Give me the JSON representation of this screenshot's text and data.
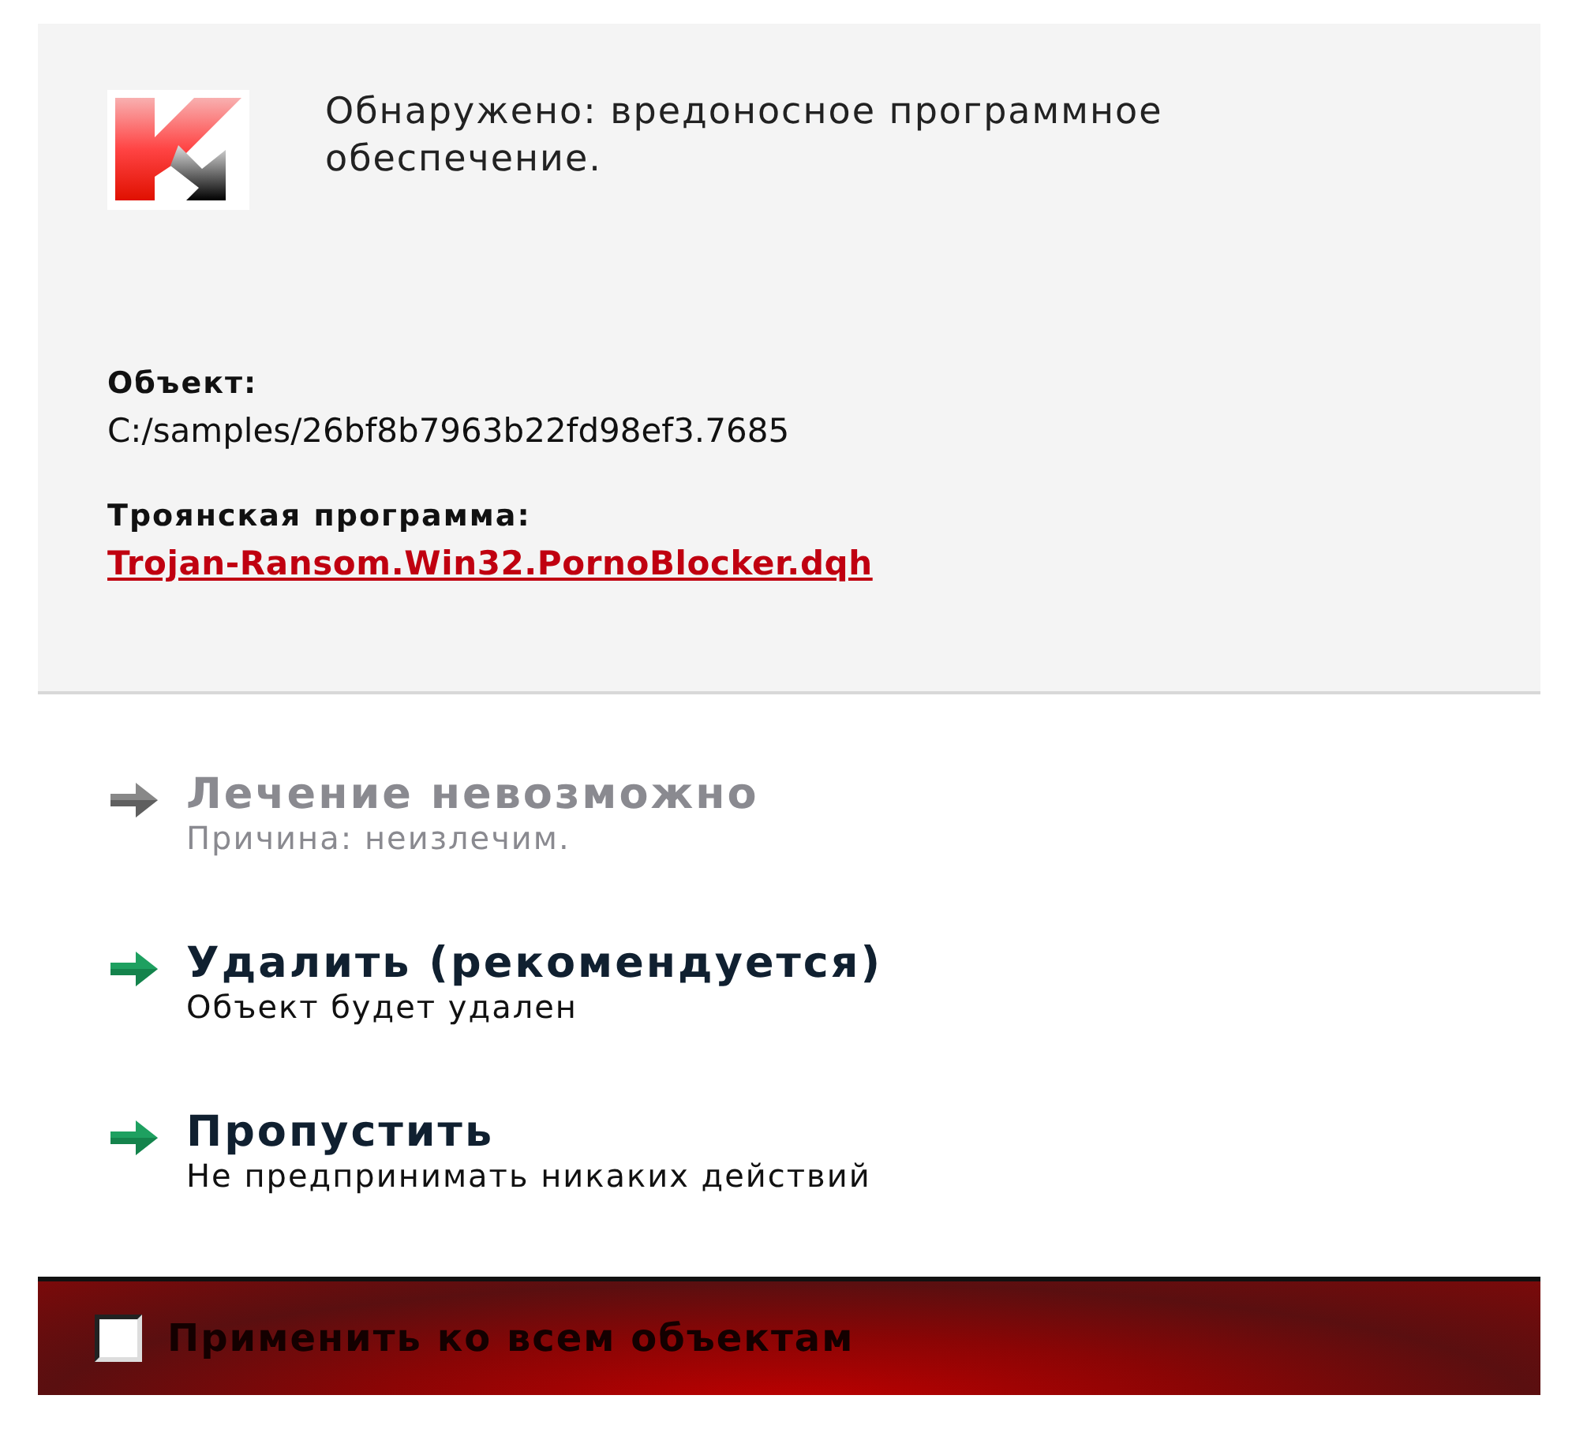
{
  "alert": {
    "message": "Обнаружено: вредоносное программное обеспечение."
  },
  "details": [
    {
      "label": "Объект:",
      "value": "C:/samples/26bf8b7963b22fd98ef3.7685",
      "kind": "plain"
    },
    {
      "label": "Троянская программа:",
      "value": "Trojan-Ransom.Win32.PornoBlocker.dqh",
      "kind": "link"
    }
  ],
  "actions": [
    {
      "title": "Лечение невозможно",
      "subtitle": "Причина: неизлечим.",
      "disabled": true
    },
    {
      "title": "Удалить (рекомендуется)",
      "subtitle": "Объект будет удален",
      "disabled": false
    },
    {
      "title": "Пропустить",
      "subtitle": "Не предпринимать никаких действий",
      "disabled": false
    }
  ],
  "apply_all": {
    "label": "Применить ко всем объектам",
    "checked": false
  }
}
